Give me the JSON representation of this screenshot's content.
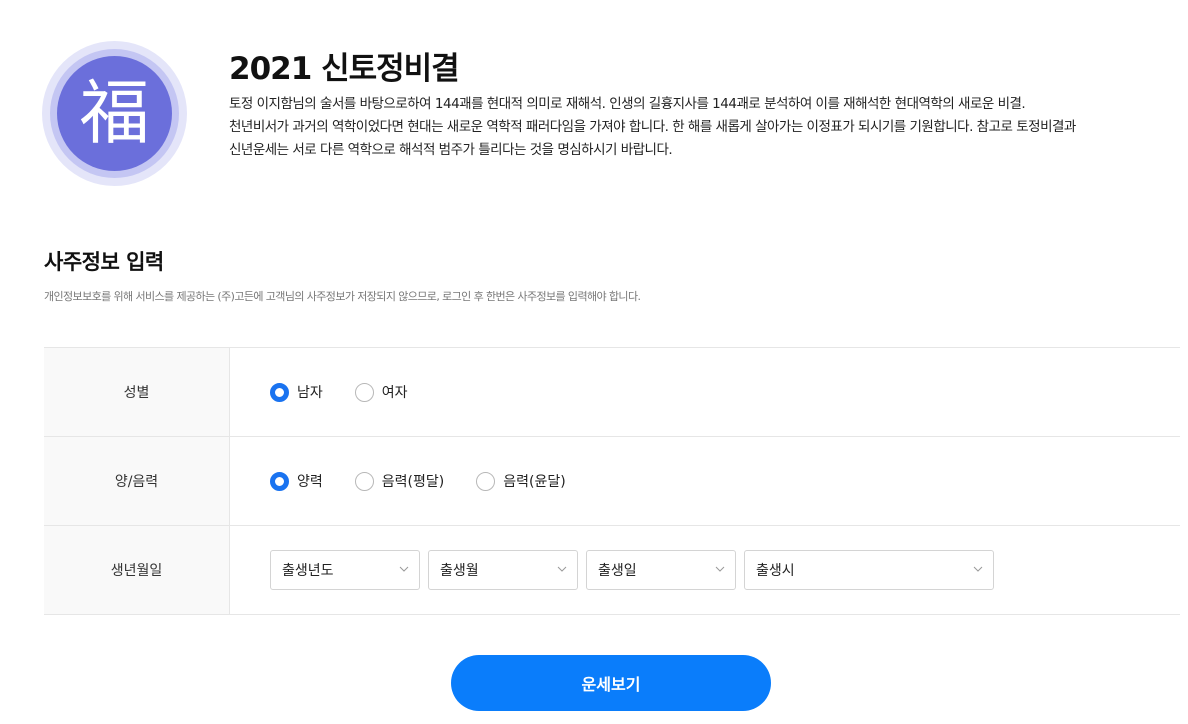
{
  "hero": {
    "emblem_char": "福",
    "title": "2021 신토정비결",
    "description_lines": [
      "토정 이지함님의 술서를 바탕으로하여 144괘를 현대적 의미로 재해석. 인생의 길흉지사를 144괘로 분석하여 이를 재해석한 현대역학의 새로운 비결.",
      "천년비서가 과거의 역학이었다면 현대는 새로운 역학적 패러다임을 가져야 합니다. 한 해를 새롭게 살아가는 이정표가 되시기를 기원합니다. 참고로 토정비결과",
      "신년운세는 서로 다른 역학으로 해석적 범주가 틀리다는 것을 명심하시기 바랍니다."
    ]
  },
  "section": {
    "title": "사주정보 입력",
    "note": "개인정보보호를 위해 서비스를 제공하는 (주)고든에 고객님의 사주정보가 저장되지 않으므로, 로그인 후 한번은 사주정보를 입력해야 합니다."
  },
  "form": {
    "gender": {
      "label": "성별",
      "options": [
        {
          "label": "남자",
          "checked": true
        },
        {
          "label": "여자",
          "checked": false
        }
      ]
    },
    "calendar": {
      "label": "양/음력",
      "options": [
        {
          "label": "양력",
          "checked": true
        },
        {
          "label": "음력(평달)",
          "checked": false
        },
        {
          "label": "음력(윤달)",
          "checked": false
        }
      ]
    },
    "birth": {
      "label": "생년월일",
      "selects": {
        "year": "출생년도",
        "month": "출생월",
        "day": "출생일",
        "hour": "출생시"
      }
    }
  },
  "submit_label": "운세보기",
  "colors": {
    "accent": "#0a7dfb",
    "emblem": "#6b6fdb"
  }
}
